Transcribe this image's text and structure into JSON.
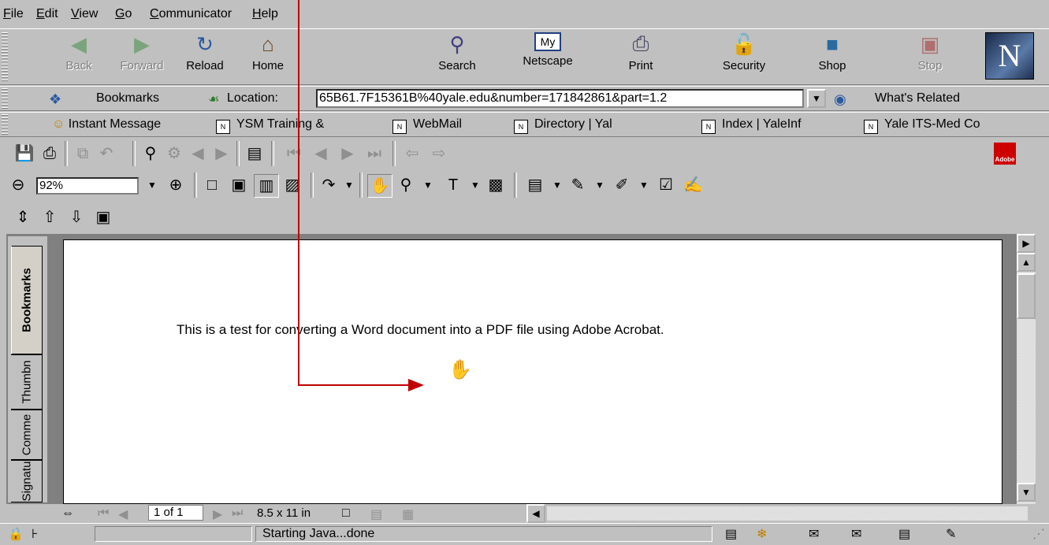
{
  "menu": [
    "File",
    "Edit",
    "View",
    "Go",
    "Communicator",
    "Help"
  ],
  "nav": {
    "buttons": [
      {
        "label": "Back",
        "icon": "back-arrow-icon",
        "enabled": false
      },
      {
        "label": "Forward",
        "icon": "forward-arrow-icon",
        "enabled": false
      },
      {
        "label": "Reload",
        "icon": "reload-icon",
        "enabled": true
      },
      {
        "label": "Home",
        "icon": "home-icon",
        "enabled": true
      },
      {
        "label": "Search",
        "icon": "search-icon",
        "enabled": true
      },
      {
        "label": "Netscape",
        "icon": "my-netscape-icon",
        "enabled": true
      },
      {
        "label": "Print",
        "icon": "printer-icon",
        "enabled": true
      },
      {
        "label": "Security",
        "icon": "padlock-icon",
        "enabled": true
      },
      {
        "label": "Shop",
        "icon": "shopping-bag-icon",
        "enabled": true
      },
      {
        "label": "Stop",
        "icon": "stop-icon",
        "enabled": false
      }
    ],
    "logo_letter": "N"
  },
  "location": {
    "bookmarks_label": "Bookmarks",
    "location_label": "Location:",
    "url": "65B61.7F15361B%40yale.edu&number=171842861&part=1.2",
    "related_label": "What's Related"
  },
  "personal": {
    "items": [
      "Instant Message",
      "YSM Training &",
      "WebMail",
      "Directory | Yal",
      "Index | YaleInf",
      "Yale ITS-Med Co"
    ]
  },
  "acrobat": {
    "zoom": "92%",
    "side_tabs": [
      "Bookmarks",
      "Thumbn",
      "Comme",
      "Signatu"
    ],
    "page_text": "This is a test for converting a Word document into a PDF file using Adobe Acrobat.",
    "page_indicator": "1 of 1",
    "page_size": "8.5 x 11 in",
    "logo_text": "Adobe"
  },
  "status": {
    "text": "Starting Java...done"
  },
  "colors": {
    "chrome": "#c0c0c0",
    "annotation": "#c00000",
    "acrobat_red": "#cc0000"
  }
}
